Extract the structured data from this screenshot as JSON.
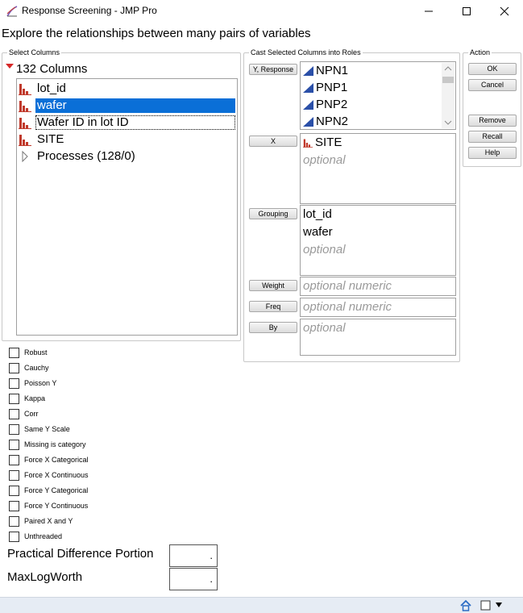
{
  "window": {
    "title": "Response Screening - JMP Pro",
    "prompt": "Explore the relationships between many pairs of variables"
  },
  "select_columns": {
    "group_label": "Select Columns",
    "count_label": "132 Columns",
    "items": [
      {
        "label": "lot_id",
        "icon": "nominal-icon"
      },
      {
        "label": "wafer",
        "icon": "nominal-icon",
        "selected": true
      },
      {
        "label": "Wafer ID in lot ID",
        "icon": "nominal-icon",
        "focused": true
      },
      {
        "label": "SITE",
        "icon": "nominal-icon"
      },
      {
        "label": "Processes (128/0)",
        "icon": "expand-triangle-icon"
      }
    ]
  },
  "cast": {
    "group_label": "Cast Selected Columns into Roles",
    "y_response": {
      "button": "Y, Response",
      "items": [
        "NPN1",
        "PNP1",
        "PNP2",
        "NPN2"
      ]
    },
    "x": {
      "button": "X",
      "items": [
        "SITE"
      ],
      "placeholder": "optional"
    },
    "grouping": {
      "button": "Grouping",
      "items": [
        "lot_id",
        "wafer"
      ],
      "placeholder": "optional"
    },
    "weight": {
      "button": "Weight",
      "placeholder": "optional numeric"
    },
    "freq": {
      "button": "Freq",
      "placeholder": "optional numeric"
    },
    "by": {
      "button": "By",
      "placeholder": "optional"
    }
  },
  "action": {
    "group_label": "Action",
    "ok": "OK",
    "cancel": "Cancel",
    "remove": "Remove",
    "recall": "Recall",
    "help": "Help"
  },
  "options": [
    "Robust",
    "Cauchy",
    "Poisson Y",
    "Kappa",
    "Corr",
    "Same Y Scale",
    "Missing is category",
    "Force X Categorical",
    "Force X Continuous",
    "Force Y Categorical",
    "Force Y Continuous",
    "Paired X and Y",
    "Unthreaded"
  ],
  "numeric_fields": {
    "practical_difference": {
      "label": "Practical Difference Portion",
      "value": "."
    },
    "max_log_worth": {
      "label": "MaxLogWorth",
      "value": "."
    }
  },
  "colors": {
    "selection": "#0a6fd7",
    "nominal_icon": "#c0392b",
    "continuous_icon": "#2a4fa8"
  }
}
